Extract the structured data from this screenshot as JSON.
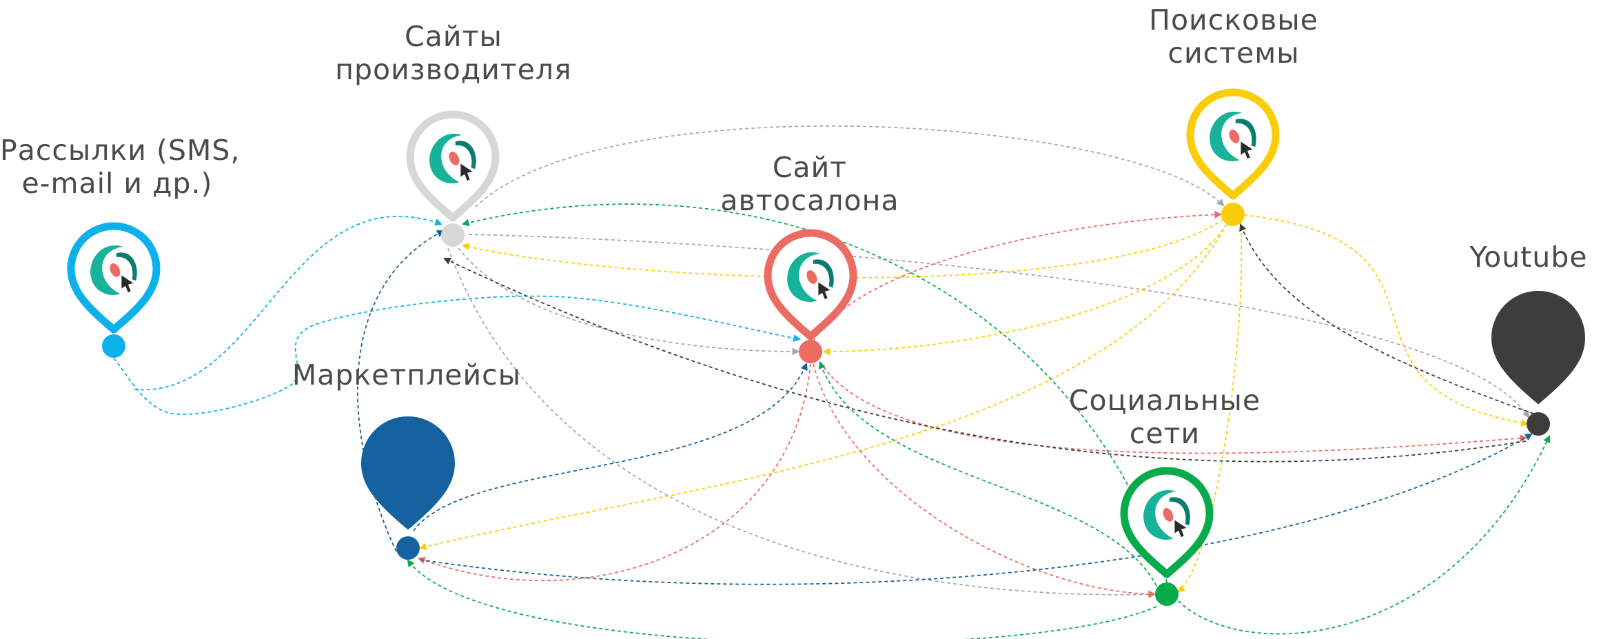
{
  "nodes": [
    {
      "id": "mailings",
      "label_lines": [
        "Рассылки (SMS,",
        "e-mail и др.)"
      ],
      "color": "#0cb0ea",
      "logo": true
    },
    {
      "id": "manufacturer",
      "label_lines": [
        "Сайты",
        "производителя"
      ],
      "color": "#d7d7d7",
      "logo": true
    },
    {
      "id": "dealer",
      "label_lines": [
        "Сайт",
        "автосалона"
      ],
      "color": "#ec6b62",
      "logo": true
    },
    {
      "id": "search",
      "label_lines": [
        "Поисковые",
        "системы"
      ],
      "color": "#f9cd07",
      "logo": true
    },
    {
      "id": "youtube",
      "label_lines": [
        "Youtube"
      ],
      "color": "#3d3d3d",
      "logo": false
    },
    {
      "id": "marketplaces",
      "label_lines": [
        "Маркетплейсы"
      ],
      "color": "#1462a0",
      "logo": false
    },
    {
      "id": "social",
      "label_lines": [
        "Социальные",
        "сети"
      ],
      "color": "#08ab4c",
      "logo": true
    }
  ],
  "edges": [
    {
      "from": "mailings",
      "to": "manufacturer",
      "color": "#0cb0ea"
    },
    {
      "from": "mailings",
      "to": "dealer",
      "color": "#0cb0ea"
    },
    {
      "from": "manufacturer",
      "to": "search",
      "color": "#a8a8a8"
    },
    {
      "from": "manufacturer",
      "to": "dealer",
      "color": "#a8a8a8"
    },
    {
      "from": "manufacturer",
      "to": "youtube",
      "color": "#a8a8a8"
    },
    {
      "from": "manufacturer",
      "to": "social",
      "color": "#a8a8a8"
    },
    {
      "from": "search",
      "to": "manufacturer",
      "color": "#f9cd07"
    },
    {
      "from": "search",
      "to": "dealer",
      "color": "#f9cd07"
    },
    {
      "from": "search",
      "to": "youtube",
      "color": "#f9cd07"
    },
    {
      "from": "search",
      "to": "marketplaces",
      "color": "#f9cd07"
    },
    {
      "from": "search",
      "to": "social",
      "color": "#f9cd07"
    },
    {
      "from": "dealer",
      "to": "search",
      "color": "#ec6b62"
    },
    {
      "from": "dealer",
      "to": "youtube",
      "color": "#ec6b62"
    },
    {
      "from": "dealer",
      "to": "marketplaces",
      "color": "#ec6b62"
    },
    {
      "from": "dealer",
      "to": "social",
      "color": "#ec6b62"
    },
    {
      "from": "youtube",
      "to": "manufacturer",
      "color": "#3d3d3d"
    },
    {
      "from": "youtube",
      "to": "search",
      "color": "#3d3d3d"
    },
    {
      "from": "marketplaces",
      "to": "manufacturer",
      "color": "#1462a0"
    },
    {
      "from": "marketplaces",
      "to": "dealer",
      "color": "#1462a0"
    },
    {
      "from": "marketplaces",
      "to": "youtube",
      "color": "#1462a0"
    },
    {
      "from": "social",
      "to": "manufacturer",
      "color": "#08ab4c"
    },
    {
      "from": "social",
      "to": "dealer",
      "color": "#08ab4c"
    },
    {
      "from": "social",
      "to": "marketplaces",
      "color": "#08ab4c"
    },
    {
      "from": "social",
      "to": "youtube",
      "color": "#08ab4c"
    }
  ]
}
